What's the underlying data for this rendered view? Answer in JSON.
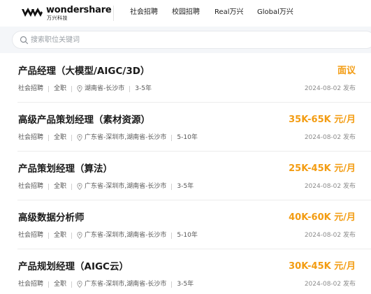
{
  "header": {
    "logo_text": "wondershare",
    "logo_sub": "万兴科技",
    "nav": [
      "社会招聘",
      "校园招聘",
      "Real万兴",
      "Global万兴"
    ]
  },
  "search": {
    "placeholder": "搜索职位关键词",
    "value": ""
  },
  "colors": {
    "salary": "#f39c12",
    "title": "#1a1a1a",
    "meta": "#555555",
    "date": "#8c8c8c",
    "search_bg": "#f4f6f9"
  },
  "jobs": [
    {
      "title": "产品经理（大模型/AIGC/3D）",
      "salary": "面议",
      "type": "社会招聘",
      "mode": "全职",
      "location": "湖南省-长沙市",
      "experience": "3-5年",
      "date": "2024-08-02 发布"
    },
    {
      "title": "高级产品策划经理（素材资源）",
      "salary": "35K-65K 元/月",
      "type": "社会招聘",
      "mode": "全职",
      "location": "广东省-深圳市,湖南省-长沙市",
      "experience": "5-10年",
      "date": "2024-08-02 发布"
    },
    {
      "title": "产品策划经理（算法）",
      "salary": "25K-45K 元/月",
      "type": "社会招聘",
      "mode": "全职",
      "location": "广东省-深圳市,湖南省-长沙市",
      "experience": "3-5年",
      "date": "2024-08-02 发布"
    },
    {
      "title": "高级数据分析师",
      "salary": "40K-60K 元/月",
      "type": "社会招聘",
      "mode": "全职",
      "location": "广东省-深圳市,湖南省-长沙市",
      "experience": "5-10年",
      "date": "2024-08-02 发布"
    },
    {
      "title": "产品规划经理（AIGC云）",
      "salary": "30K-45K 元/月",
      "type": "社会招聘",
      "mode": "全职",
      "location": "广东省-深圳市,湖南省-长沙市",
      "experience": "3-5年",
      "date": "2024-08-02 发布"
    }
  ]
}
